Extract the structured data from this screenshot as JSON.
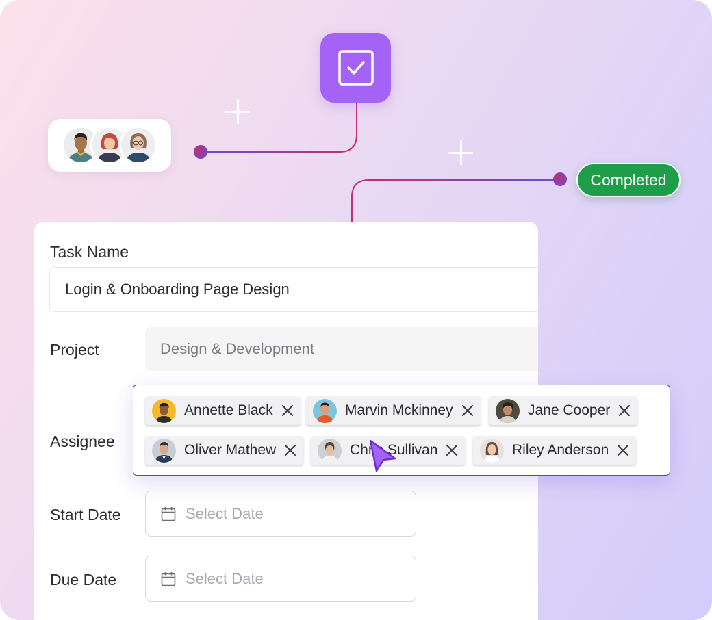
{
  "status": {
    "label": "Completed"
  },
  "form": {
    "task_name_label": "Task Name",
    "task_name_value": "Login & Onboarding Page Design",
    "project_label": "Project",
    "project_value": "Design & Development",
    "assignee_label": "Assignee",
    "start_date_label": "Start Date",
    "start_date_placeholder": "Select Date",
    "due_date_label": "Due Date",
    "due_date_placeholder": "Select Date"
  },
  "assignees": [
    {
      "name": "Annette Black"
    },
    {
      "name": "Marvin Mckinney"
    },
    {
      "name": "Jane Cooper"
    },
    {
      "name": "Oliver Mathew"
    },
    {
      "name": "Chris Sullivan"
    },
    {
      "name": "Riley Anderson"
    }
  ],
  "icons": {
    "app": "check-square-icon",
    "calendar": "calendar-icon",
    "remove": "close-icon",
    "pointer": "cursor-arrow-icon"
  },
  "colors": {
    "accent": "#a463f6",
    "selection_border": "#5644c7",
    "success": "#1e9e49"
  }
}
